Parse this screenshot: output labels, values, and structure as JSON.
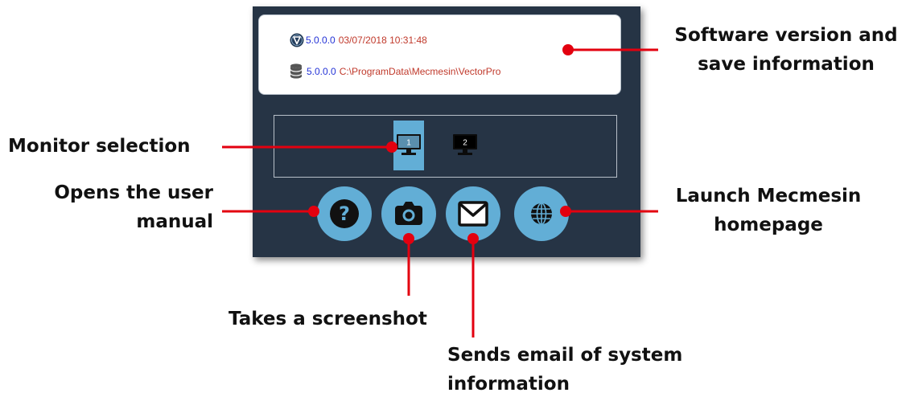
{
  "info": {
    "app_version": "5.0.0.0",
    "save_timestamp": "03/07/2018 10:31:48",
    "data_version": "5.0.0.0",
    "data_path": "C:\\ProgramData\\Mecmesin\\VectorPro"
  },
  "monitors": [
    {
      "label": "1",
      "selected": true
    },
    {
      "label": "2",
      "selected": false
    }
  ],
  "buttons": {
    "help_icon": "question-icon",
    "screenshot_icon": "camera-icon",
    "email_icon": "envelope-icon",
    "web_icon": "globe-icon"
  },
  "annotations": {
    "software_version_1": "Software version and",
    "software_version_2": "save information",
    "monitor_selection": "Monitor selection",
    "user_manual_1": "Opens the user",
    "user_manual_2": "manual",
    "homepage_1": "Launch Mecmesin",
    "homepage_2": "homepage",
    "screenshot": "Takes a screenshot",
    "email_1": "Sends email of system",
    "email_2": "information"
  },
  "colors": {
    "panel": "#263445",
    "accent": "#62aed6",
    "callout": "#e3000f",
    "version_text": "#2433d6",
    "path_text": "#c0392b"
  }
}
